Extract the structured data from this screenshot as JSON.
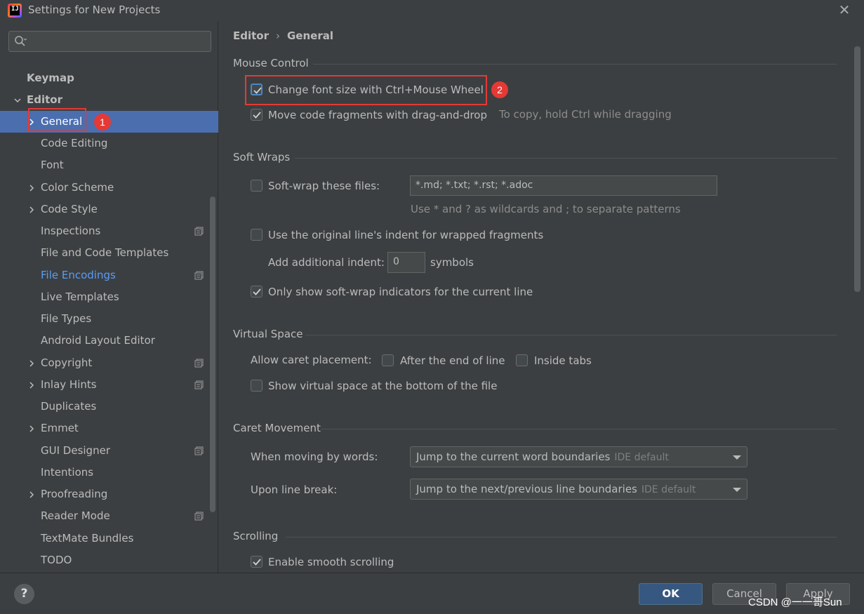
{
  "window": {
    "title": "Settings for New Projects",
    "logo_text": "IJ"
  },
  "search": {
    "placeholder": ""
  },
  "sidebar": {
    "items": [
      {
        "label": "Keymap"
      },
      {
        "label": "Editor"
      },
      {
        "label": "General"
      },
      {
        "label": "Code Editing"
      },
      {
        "label": "Font"
      },
      {
        "label": "Color Scheme"
      },
      {
        "label": "Code Style"
      },
      {
        "label": "Inspections"
      },
      {
        "label": "File and Code Templates"
      },
      {
        "label": "File Encodings"
      },
      {
        "label": "Live Templates"
      },
      {
        "label": "File Types"
      },
      {
        "label": "Android Layout Editor"
      },
      {
        "label": "Copyright"
      },
      {
        "label": "Inlay Hints"
      },
      {
        "label": "Duplicates"
      },
      {
        "label": "Emmet"
      },
      {
        "label": "GUI Designer"
      },
      {
        "label": "Intentions"
      },
      {
        "label": "Proofreading"
      },
      {
        "label": "Reader Mode"
      },
      {
        "label": "TextMate Bundles"
      },
      {
        "label": "TODO"
      }
    ],
    "selected": "General"
  },
  "annotations": {
    "badge1": "1",
    "badge2": "2"
  },
  "breadcrumb": {
    "parent": "Editor",
    "sep": "›",
    "current": "General"
  },
  "mouse_control": {
    "title": "Mouse Control",
    "change_font": {
      "label": "Change font size with Ctrl+Mouse Wheel",
      "checked": true
    },
    "move_code": {
      "label": "Move code fragments with drag-and-drop",
      "checked": true
    },
    "move_hint": "To copy, hold Ctrl while dragging"
  },
  "soft_wraps": {
    "title": "Soft Wraps",
    "soft_wrap_files": {
      "label": "Soft-wrap these files:",
      "checked": false
    },
    "patterns_value": "*.md; *.txt; *.rst; *.adoc",
    "patterns_hint": "Use * and ? as wildcards and ; to separate patterns",
    "original_indent": {
      "label": "Use the original line's indent for wrapped fragments",
      "checked": false
    },
    "additional_indent_label": "Add additional indent:",
    "additional_indent_value": "0",
    "symbols_label": "symbols",
    "only_show": {
      "label": "Only show soft-wrap indicators for the current line",
      "checked": true
    }
  },
  "virtual_space": {
    "title": "Virtual Space",
    "caret_label": "Allow caret placement:",
    "after_end": {
      "label": "After the end of line",
      "checked": false
    },
    "inside_tabs": {
      "label": "Inside tabs",
      "checked": false
    },
    "show_virtual": {
      "label": "Show virtual space at the bottom of the file",
      "checked": false
    }
  },
  "caret_movement": {
    "title": "Caret Movement",
    "words_label": "When moving by words:",
    "words_value": "Jump to the current word boundaries",
    "words_default": "IDE default",
    "line_label": "Upon line break:",
    "line_value": "Jump to the next/previous line boundaries",
    "line_default": "IDE default"
  },
  "scrolling": {
    "title": "Scrolling",
    "smooth": {
      "label": "Enable smooth scrolling",
      "checked": true
    }
  },
  "buttons": {
    "help": "?",
    "ok": "OK",
    "cancel": "Cancel",
    "apply": "Apply"
  },
  "watermark": "CSDN @一一哥Sun",
  "colors": {
    "selected": "#4b6eaf",
    "link": "#589df6",
    "accent_red": "#e53935",
    "ok_button": "#365880"
  }
}
